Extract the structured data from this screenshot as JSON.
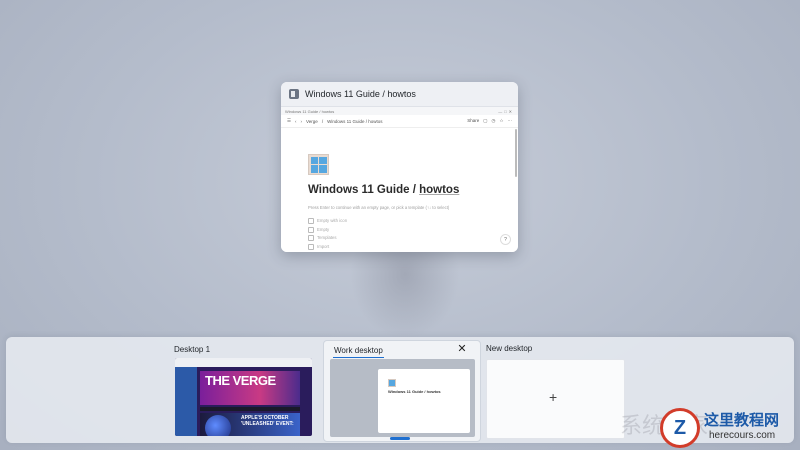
{
  "window": {
    "title": "Windows 11 Guide / howtos",
    "tab_text": "Windows 11 Guide / howtos",
    "breadcrumb_1": "Verge",
    "breadcrumb_2": "Windows 11 Guide / howtos",
    "share_label": "Share",
    "page": {
      "title_part1": "Windows 11 Guide / ",
      "title_part2": "howtos",
      "hint": "Press Enter to continue with an empty page, or pick a template (↑↓ to select)",
      "options": [
        "Empty with icon",
        "Empty",
        "Templates",
        "Import"
      ],
      "help": "?"
    }
  },
  "desktops": [
    {
      "label": "Desktop 1"
    },
    {
      "label": "Work desktop"
    },
    {
      "label": "New desktop"
    }
  ],
  "desktop1_thumb": {
    "headline": "THE VERGE",
    "subline": "APPLE'S OCTOBER 'UNLEASHED' EVENT:"
  },
  "desktop2_thumb": {
    "title": "Windows 11 Guide / howtos"
  },
  "new_desktop": {
    "plus": "+"
  },
  "close_glyph": "✕",
  "watermark": {
    "cn": "这里教程网",
    "en": "herecours.com",
    "faint": "系统之家",
    "logo_letter": "Z"
  }
}
